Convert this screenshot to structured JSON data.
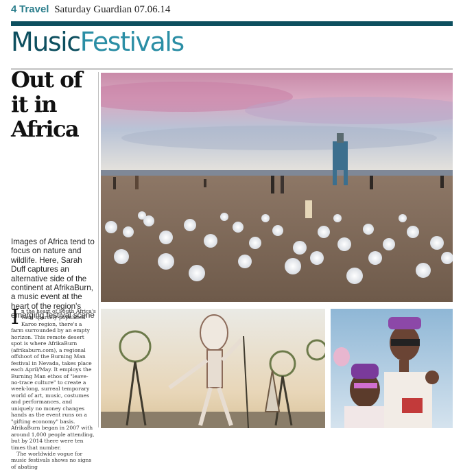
{
  "header": {
    "page_number": "4",
    "section": "Travel",
    "publication_date": "Saturday Guardian 07.06.14"
  },
  "kicker": {
    "part1": "Music",
    "part2": "Festivals"
  },
  "article": {
    "headline": [
      "Out of",
      "it in",
      "Africa"
    ],
    "standfirst": "Images of Africa tend to focus on nature and wildlife. Here, Sarah Duff captures an alternative side of the continent at AfrikaBurn, a music event at the heart of the region's emerging festival scene",
    "dropcap": "I",
    "body_first": "n the heart of South Africa's vast, sparsely populated Karoo region, there's a farm surrounded by an empty horizon. This remote desert spot is where AfrikaBurn (afrikaburn.com), a regional offshoot of the Burning Man festival in Nevada, takes place each April/May. It employs the Burning Man ethos of \"leave-no-trace culture\" to create a week-long, surreal temporary world of art, music, costumes and performances, and uniquely no money changes hands as the event runs on a \"gifting economy\" basis. AfrikaBurn began in 2007 with around 1,000 people attending, but by 2014 there were ten times that number.",
    "body_second": "The worldwide vogue for music festivals shows no signs of abating"
  },
  "colors": {
    "brand_dark": "#0d4f5f",
    "brand_light": "#2b8ea5",
    "section_accent": "#2b7e8c"
  }
}
